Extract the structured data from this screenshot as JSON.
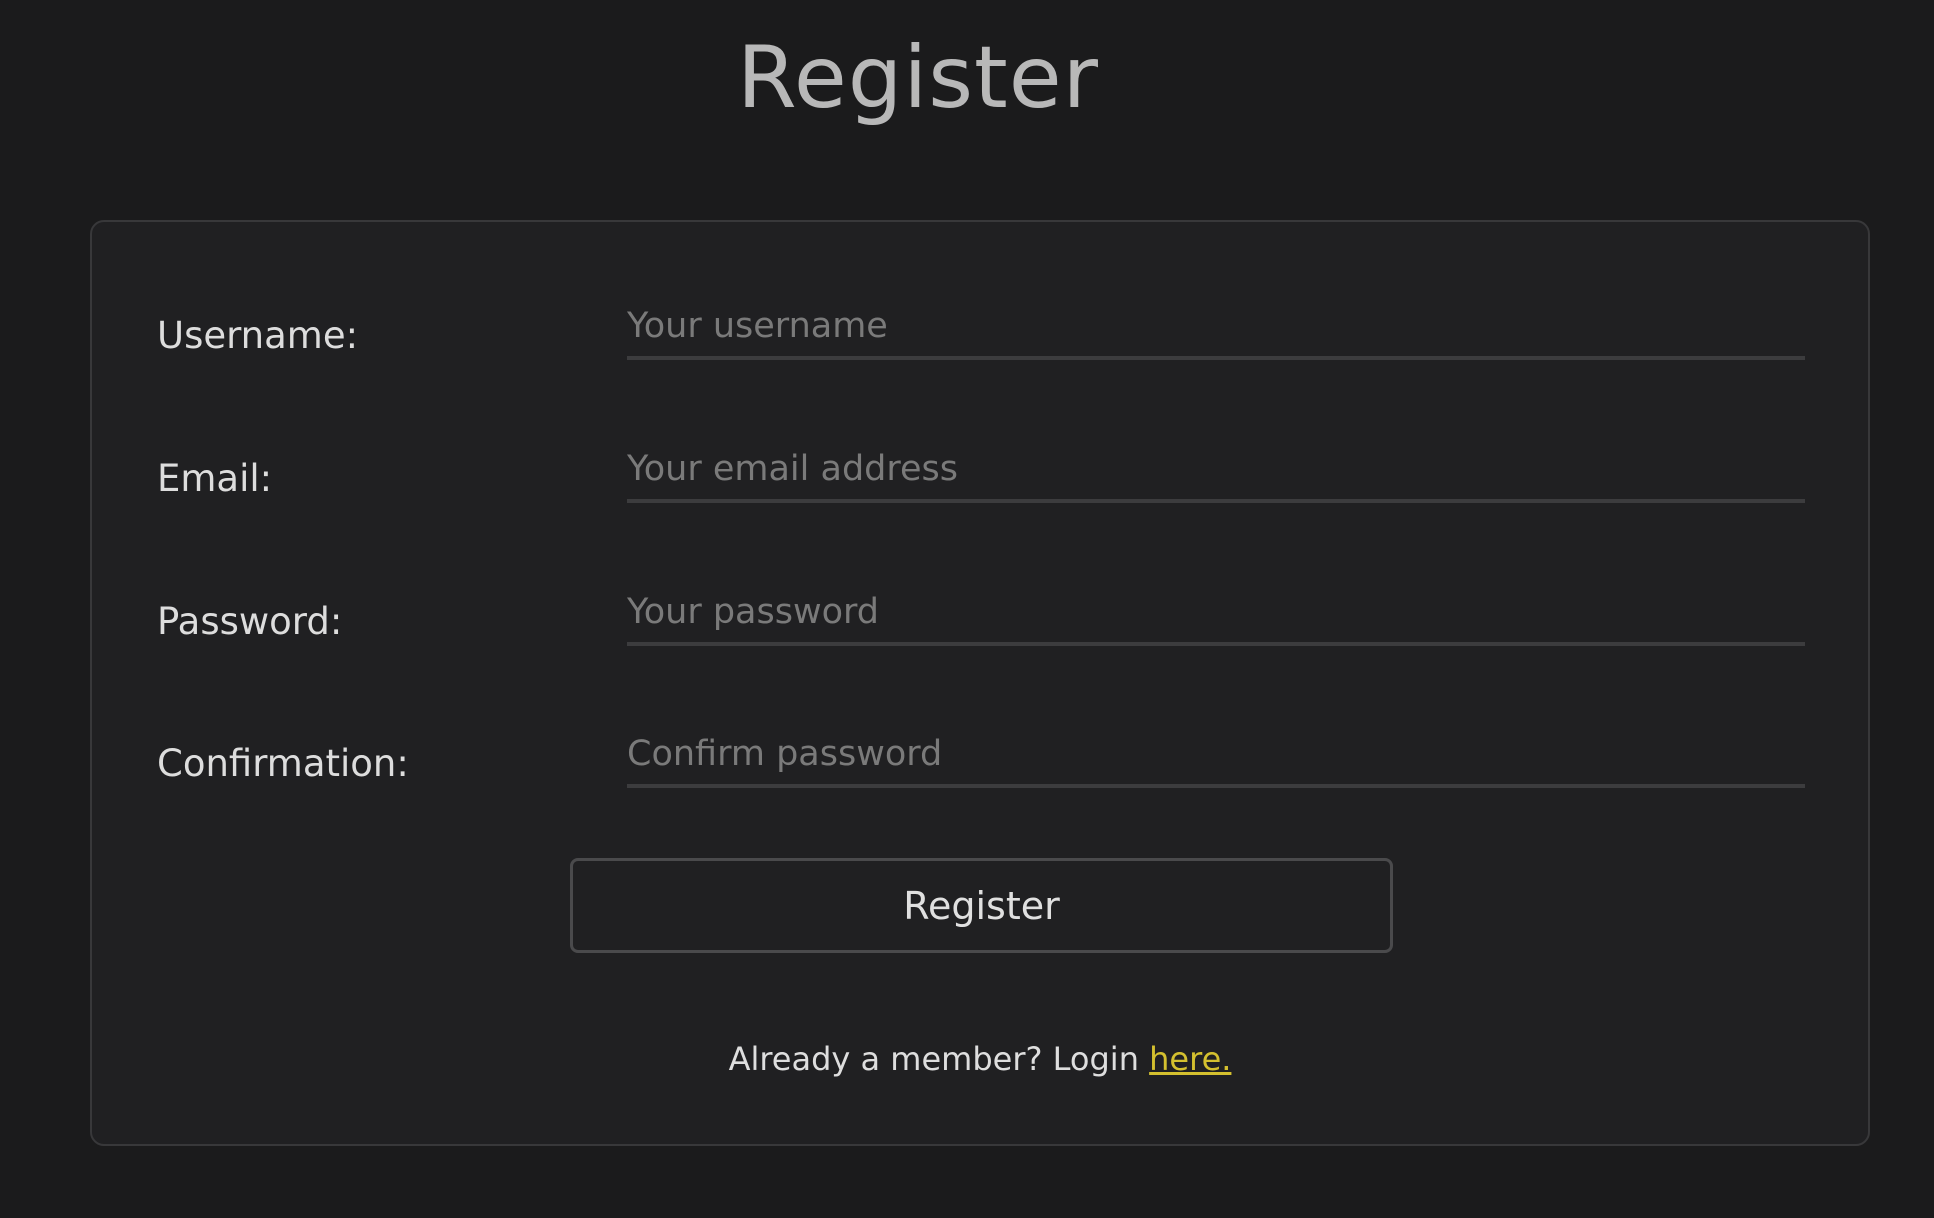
{
  "page": {
    "title": "Register"
  },
  "form": {
    "fields": [
      {
        "label": "Username:",
        "placeholder": "Your username",
        "value": ""
      },
      {
        "label": "Email:",
        "placeholder": "Your email address",
        "value": ""
      },
      {
        "label": "Password:",
        "placeholder": "Your password",
        "value": ""
      },
      {
        "label": "Confirmation:",
        "placeholder": "Confirm password",
        "value": ""
      }
    ],
    "submit_label": "Register"
  },
  "footer": {
    "prompt_text": "Already a member? Login ",
    "link_text": "here."
  },
  "colors": {
    "background": "#1b1b1c",
    "card": "#202022",
    "link": "#d4c02f"
  }
}
